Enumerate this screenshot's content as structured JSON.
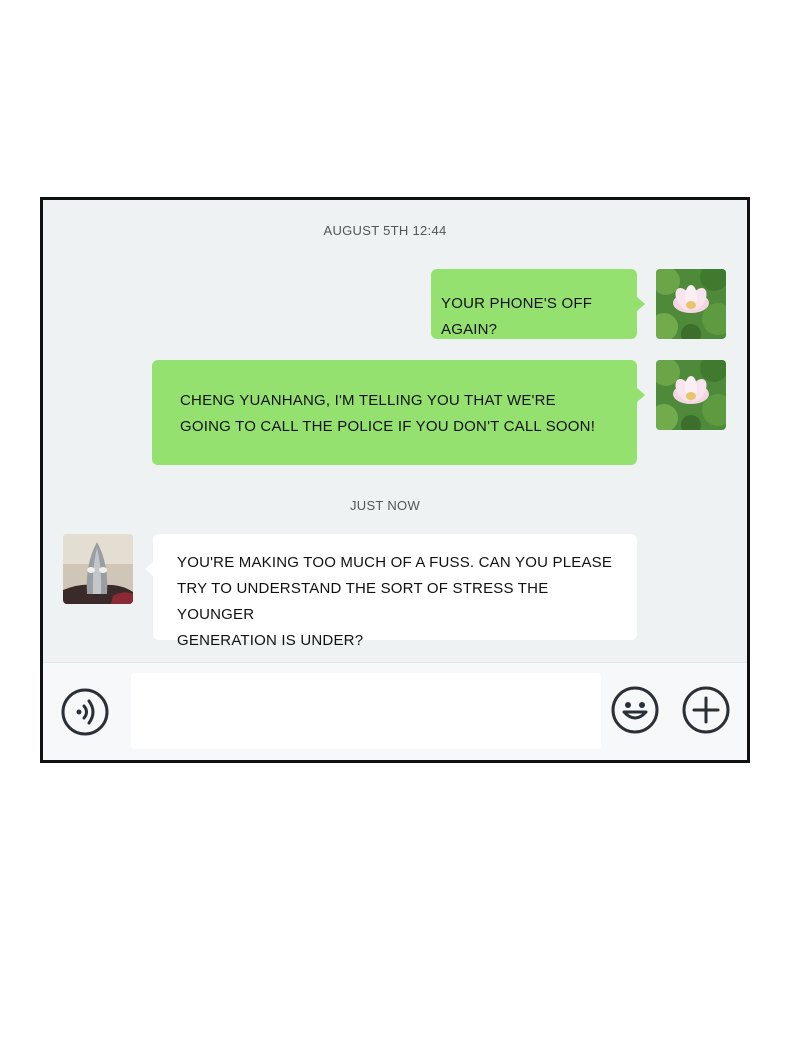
{
  "chat": {
    "timestamps": [
      "AUGUST 5TH 12:44",
      "JUST NOW"
    ],
    "messages": [
      {
        "side": "right",
        "color": "#95e16f",
        "text": "YOUR PHONE'S OFF AGAIN?"
      },
      {
        "side": "right",
        "color": "#95e16f",
        "text_lines": [
          "CHENG YUANHANG, I'M TELLING YOU THAT WE'RE",
          "GOING TO CALL THE POLICE IF YOU DON'T CALL SOON!"
        ]
      },
      {
        "side": "left",
        "color": "#ffffff",
        "text_lines": [
          "YOU'RE MAKING TOO MUCH OF A FUSS. CAN YOU PLEASE",
          "TRY TO UNDERSTAND THE SORT OF STRESS THE YOUNGER",
          "GENERATION IS UNDER?"
        ]
      }
    ]
  },
  "input_bar": {
    "icons": [
      "voice-icon",
      "emoji-icon",
      "plus-icon"
    ]
  },
  "colors": {
    "sent_bubble": "#95e16f",
    "received_bubble": "#ffffff",
    "chat_background": "#eef2f3",
    "icon_stroke": "#2b3036"
  }
}
